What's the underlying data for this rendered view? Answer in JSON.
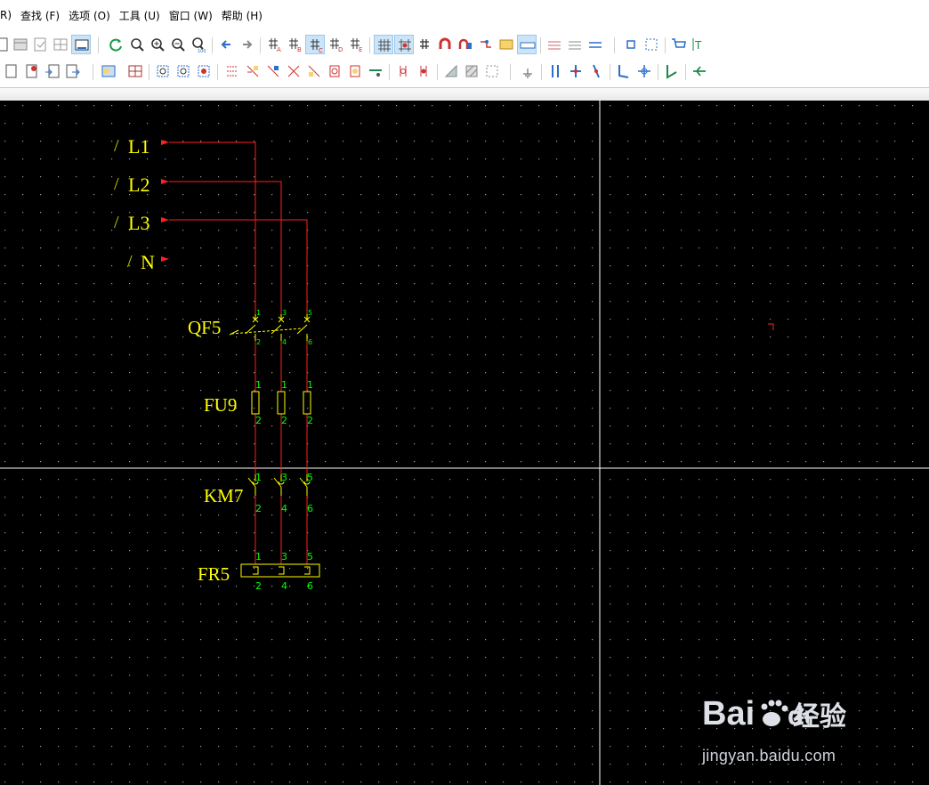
{
  "menu": {
    "items": [
      "R)",
      "查找 (F)",
      "选项 (O)",
      "工具 (U)",
      "窗口 (W)",
      "帮助 (H)"
    ]
  },
  "colors": {
    "canvas_bg": "#000000",
    "wire": "#ff2020",
    "label": "#ffff00",
    "pin": "#00ff00",
    "crosshair": "#ffffff"
  },
  "schematic": {
    "buses": [
      {
        "slash": "/",
        "label": "L1"
      },
      {
        "slash": "/",
        "label": "L2"
      },
      {
        "slash": "/",
        "label": "L3"
      },
      {
        "slash": "/",
        "label": "N"
      }
    ],
    "qf": {
      "label": "QF5",
      "pins_top": [
        "1",
        "3",
        "5"
      ],
      "pins_bottom": [
        "2",
        "4",
        "6"
      ]
    },
    "fu": {
      "label": "FU9",
      "pins_top": [
        "1",
        "1",
        "1"
      ],
      "pins_bottom": [
        "2",
        "2",
        "2"
      ]
    },
    "km": {
      "label": "KM7",
      "pins_top": [
        "1",
        "3",
        "5"
      ],
      "pins_bottom": [
        "2",
        "4",
        "6"
      ]
    },
    "fr": {
      "label": "FR5",
      "pins_top": [
        "1",
        "3",
        "5"
      ],
      "pins_bottom": [
        "2",
        "4",
        "6"
      ]
    }
  },
  "watermark": {
    "brand": "Bai",
    "brand_tail": "du",
    "cn": "经验",
    "domain": "jingyan.baidu.com"
  }
}
